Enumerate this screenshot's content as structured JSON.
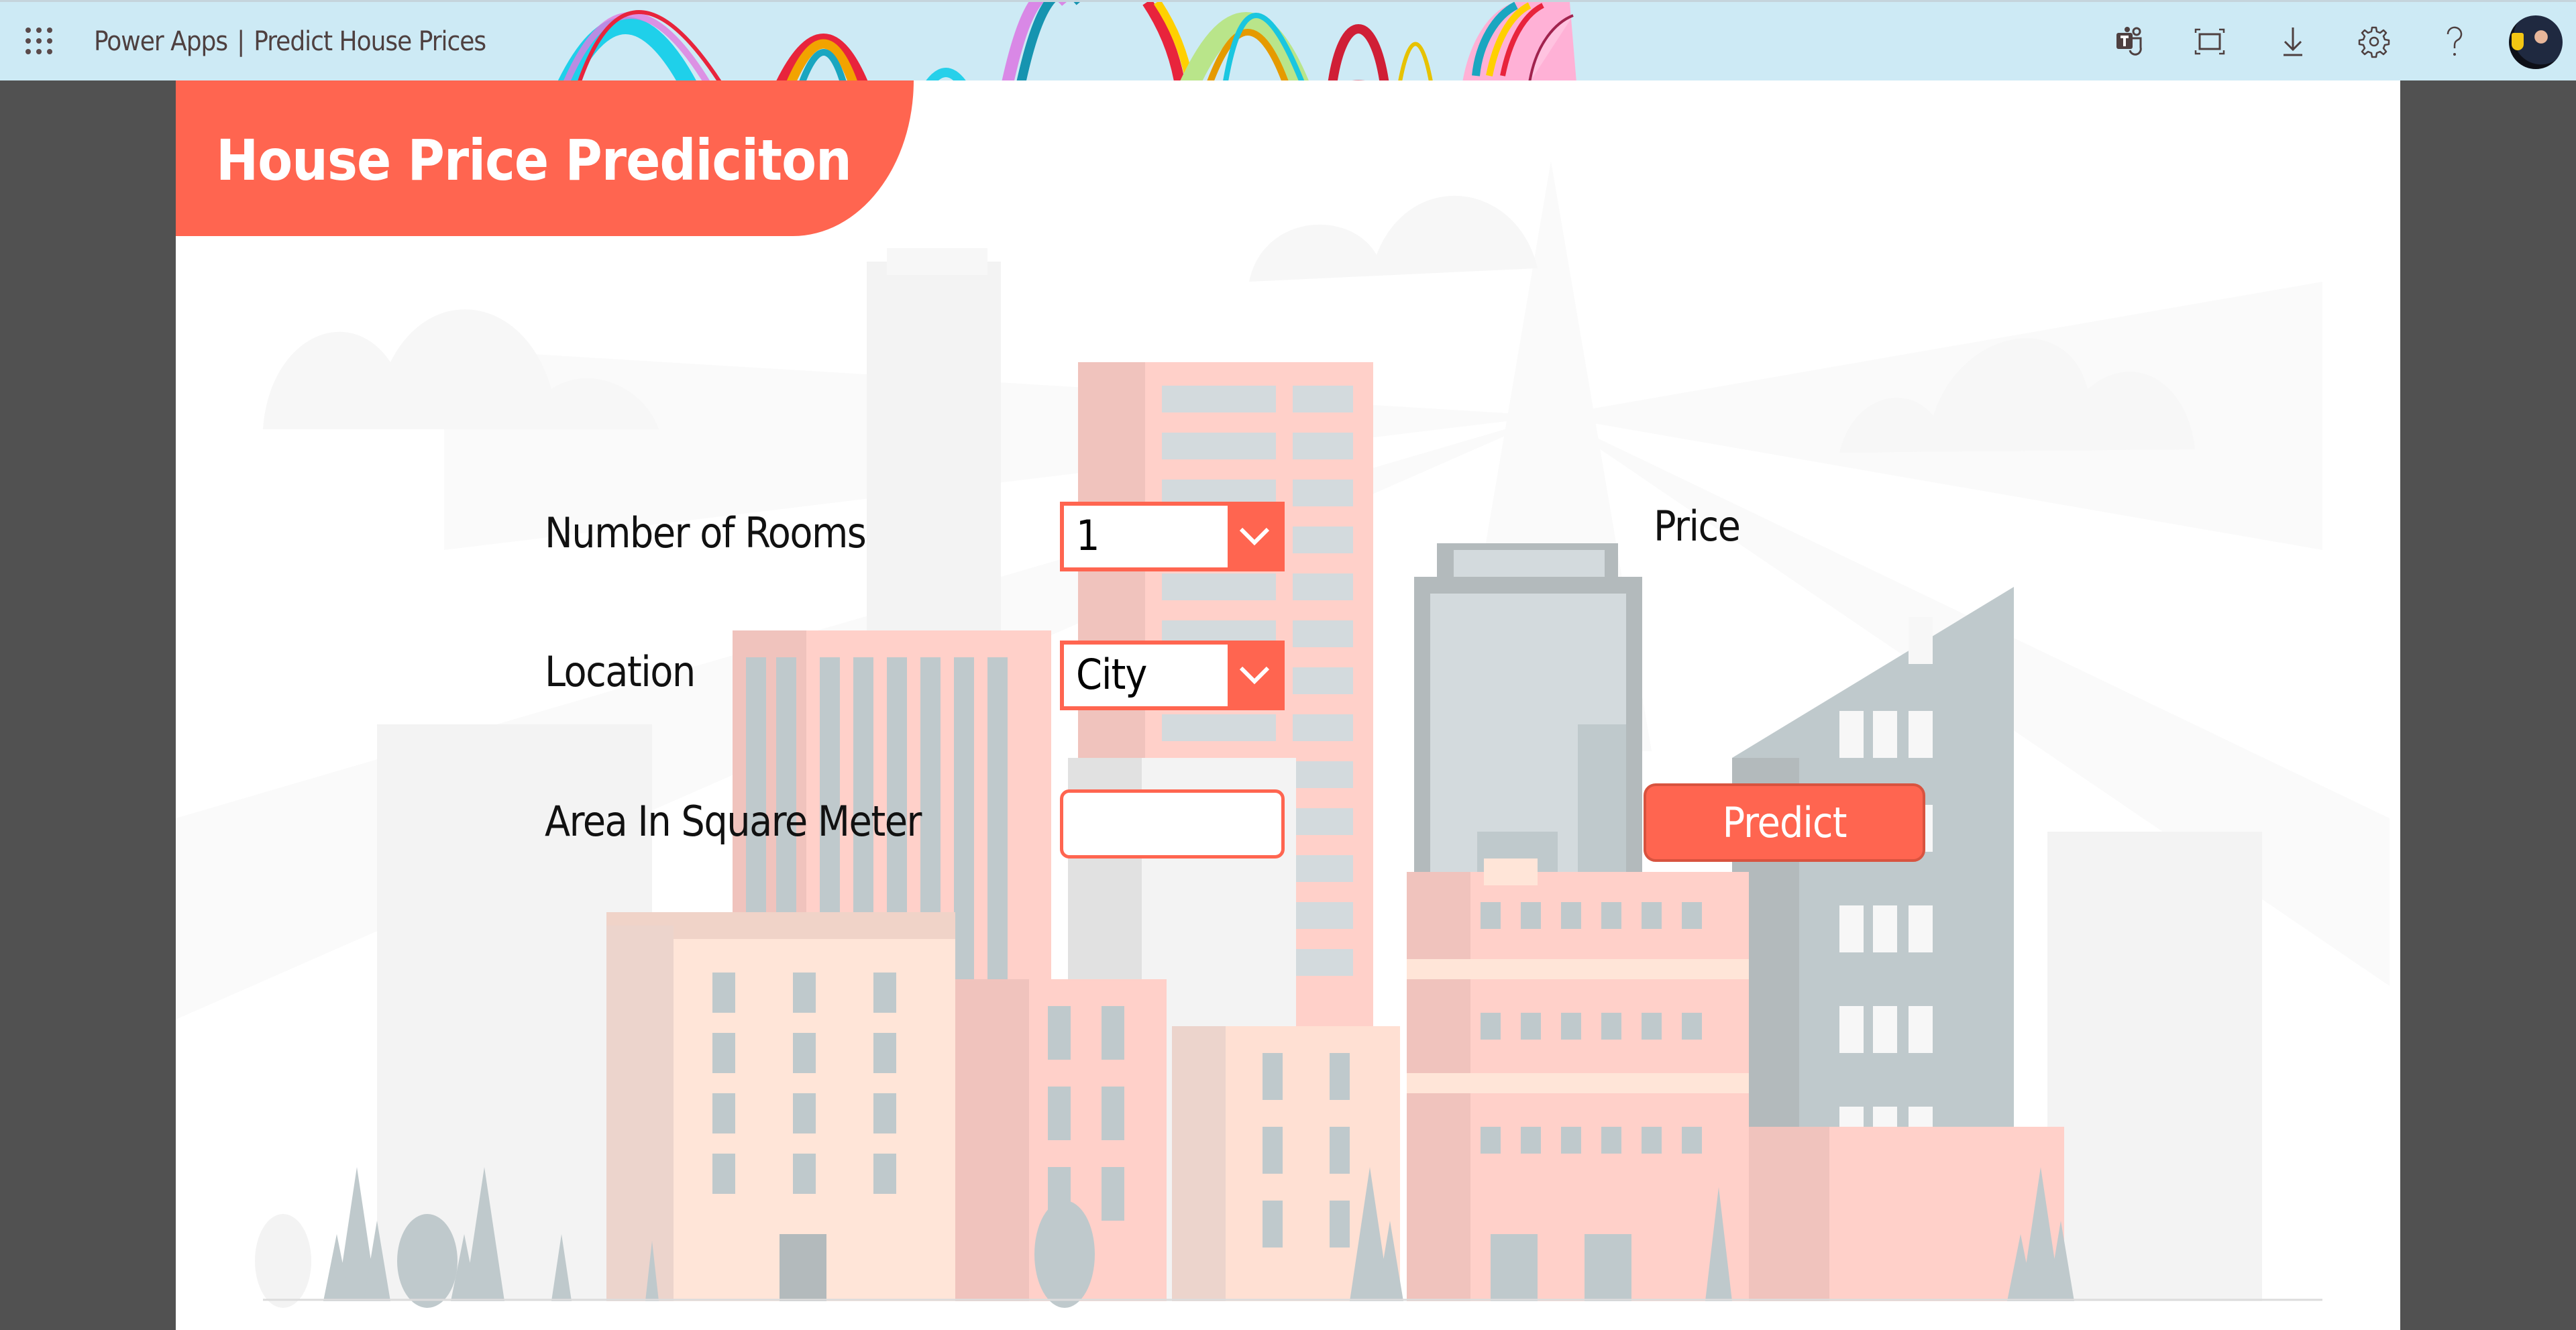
{
  "topbar": {
    "app_name": "Power Apps",
    "separator": "|",
    "app_title": "Predict House Prices",
    "icons": [
      {
        "name": "teams-icon",
        "label": "Microsoft Teams"
      },
      {
        "name": "fit-to-window-icon",
        "label": "Fit to window"
      },
      {
        "name": "download-icon",
        "label": "Download"
      },
      {
        "name": "settings-gear-icon",
        "label": "Settings"
      },
      {
        "name": "help-question-icon",
        "label": "Help"
      }
    ],
    "background_color": "#cdeaf5"
  },
  "app": {
    "header_title": "House Price Prediciton",
    "accent_color": "#ff6550",
    "fields": {
      "rooms": {
        "label": "Number of Rooms",
        "selected": "1"
      },
      "location": {
        "label": "Location",
        "selected": "City"
      },
      "area": {
        "label": "Area In Square Meter",
        "value": "",
        "placeholder": ""
      }
    },
    "price_label": "Price",
    "predict_button": "Predict"
  }
}
